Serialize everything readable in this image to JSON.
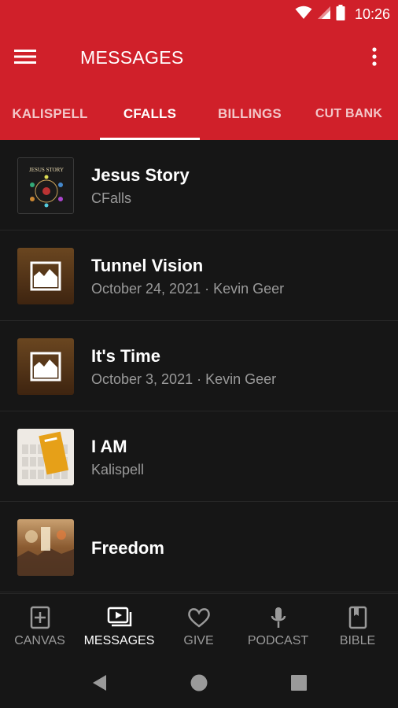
{
  "status_bar": {
    "time": "10:26"
  },
  "app_bar": {
    "title": "MESSAGES"
  },
  "tabs": [
    {
      "label": "KALISPELL",
      "active": false
    },
    {
      "label": "CFALLS",
      "active": true
    },
    {
      "label": "BILLINGS",
      "active": false
    },
    {
      "label": "CUT BANK",
      "active": false
    }
  ],
  "messages": [
    {
      "title": "Jesus Story",
      "subtitle": "CFalls",
      "thumb_text": "JESUS STORY"
    },
    {
      "title": "Tunnel Vision",
      "subtitle": "October 24, 2021 · Kevin Geer"
    },
    {
      "title": "It's Time",
      "subtitle": "October 3, 2021 · Kevin Geer"
    },
    {
      "title": "I AM",
      "subtitle": "Kalispell"
    },
    {
      "title": "Freedom",
      "subtitle": ""
    }
  ],
  "bottom_nav": [
    {
      "label": "CANVAS",
      "icon": "add-box-icon",
      "active": false
    },
    {
      "label": "MESSAGES",
      "icon": "video-library-icon",
      "active": true
    },
    {
      "label": "GIVE",
      "icon": "heart-icon",
      "active": false
    },
    {
      "label": "PODCAST",
      "icon": "microphone-icon",
      "active": false
    },
    {
      "label": "BIBLE",
      "icon": "book-icon",
      "active": false
    }
  ],
  "colors": {
    "brand_red": "#d0202a",
    "background": "#161616",
    "secondary_text": "#9a9a9a"
  }
}
